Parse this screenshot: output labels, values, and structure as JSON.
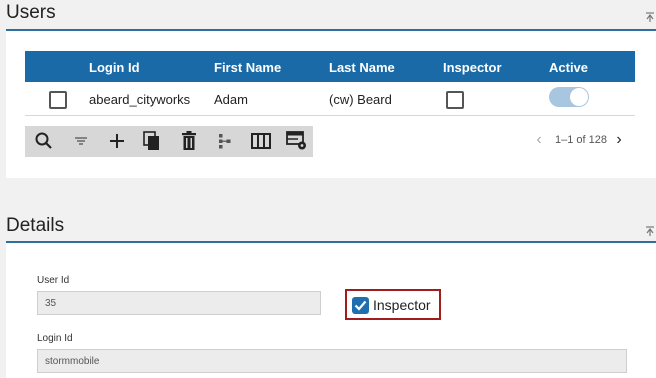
{
  "users_section": {
    "title": "Users",
    "table": {
      "columns": [
        "Login Id",
        "First Name",
        "Last Name",
        "Inspector",
        "Active"
      ],
      "rows": [
        {
          "login_id": "abeard_cityworks",
          "first_name": "Adam",
          "last_name": "(cw) Beard",
          "inspector": false,
          "active": true
        }
      ]
    },
    "toolbar_icons": [
      "search-icon",
      "filter-icon",
      "add-icon",
      "copy-icon",
      "delete-icon",
      "hierarchy-icon",
      "columns-icon",
      "table-settings-icon"
    ],
    "pagination": {
      "text": "1–1 of 128"
    }
  },
  "details_section": {
    "title": "Details",
    "user_id_label": "User Id",
    "user_id_value": "35",
    "login_id_label": "Login Id",
    "login_id_value": "stormmobile",
    "inspector_label": "Inspector",
    "inspector_checked": true
  },
  "colors": {
    "header_blue": "#1a6aa8",
    "accent_rule": "#2e6f9e",
    "highlight_red": "#a11c1c"
  }
}
